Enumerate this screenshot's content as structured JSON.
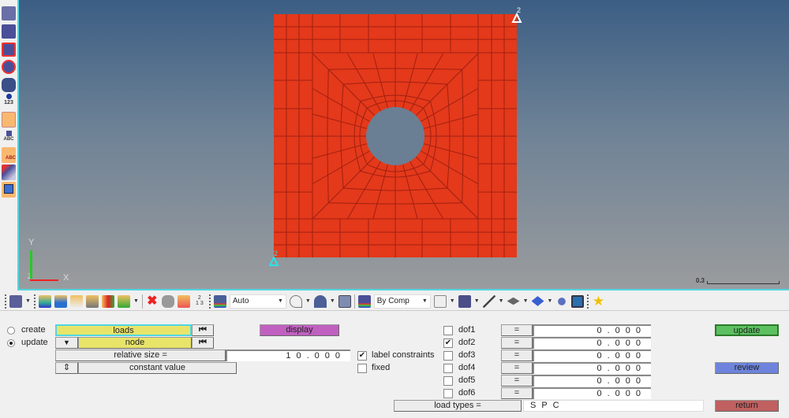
{
  "viewport": {
    "constraint_label": "2",
    "axes": {
      "x": "X",
      "y": "Y",
      "z": "Z"
    },
    "scale_label": "0.3",
    "colors": {
      "plate": "#e4391b",
      "mesh_line": "#a02010",
      "constraint_top": "#ffffff",
      "constraint_bottom": "#2ee0e8"
    }
  },
  "left_toolbar": {
    "icons": [
      "mesh-icon",
      "mesh-shaded-icon",
      "mesh-box-select-icon",
      "mesh-circle-select-icon",
      "binoculars-icon",
      "info-123-icon",
      "numbers-scale-icon",
      "element-abc-icon",
      "load-abc-icon",
      "load-transfer-icon",
      "plane-icon"
    ],
    "labels": {
      "info": "123",
      "element": "ABC",
      "load": "ABC"
    }
  },
  "toolbar": {
    "auto_select": "Auto",
    "color_select": "By Comp"
  },
  "panel": {
    "create_label": "create",
    "update_label": "update",
    "mode": "update",
    "loads_label": "loads",
    "node_label": "node",
    "relative_size_label": "relative size =",
    "relative_size_value": "10.000",
    "constant_value_label": "constant value",
    "display_label": "display",
    "label_constraints_label": "label constraints",
    "label_constraints_checked": true,
    "fixed_label": "fixed",
    "fixed_checked": false,
    "dofs": [
      {
        "label": "dof1",
        "checked": false,
        "eq": "=",
        "value": "0.000"
      },
      {
        "label": "dof2",
        "checked": true,
        "eq": "=",
        "value": "0.000"
      },
      {
        "label": "dof3",
        "checked": false,
        "eq": "=",
        "value": "0.000"
      },
      {
        "label": "dof4",
        "checked": false,
        "eq": "=",
        "value": "0.000"
      },
      {
        "label": "dof5",
        "checked": false,
        "eq": "=",
        "value": "0.000"
      },
      {
        "label": "dof6",
        "checked": false,
        "eq": "=",
        "value": "0.000"
      }
    ],
    "load_types_label": "load types =",
    "load_types_value": "SPC",
    "update_button": "update",
    "review_button": "review",
    "return_button": "return",
    "colors": {
      "yellow": "#e8e46a",
      "display": "#c060c0",
      "update": "#5cc060",
      "review": "#6e84dc",
      "return": "#c06060"
    }
  }
}
